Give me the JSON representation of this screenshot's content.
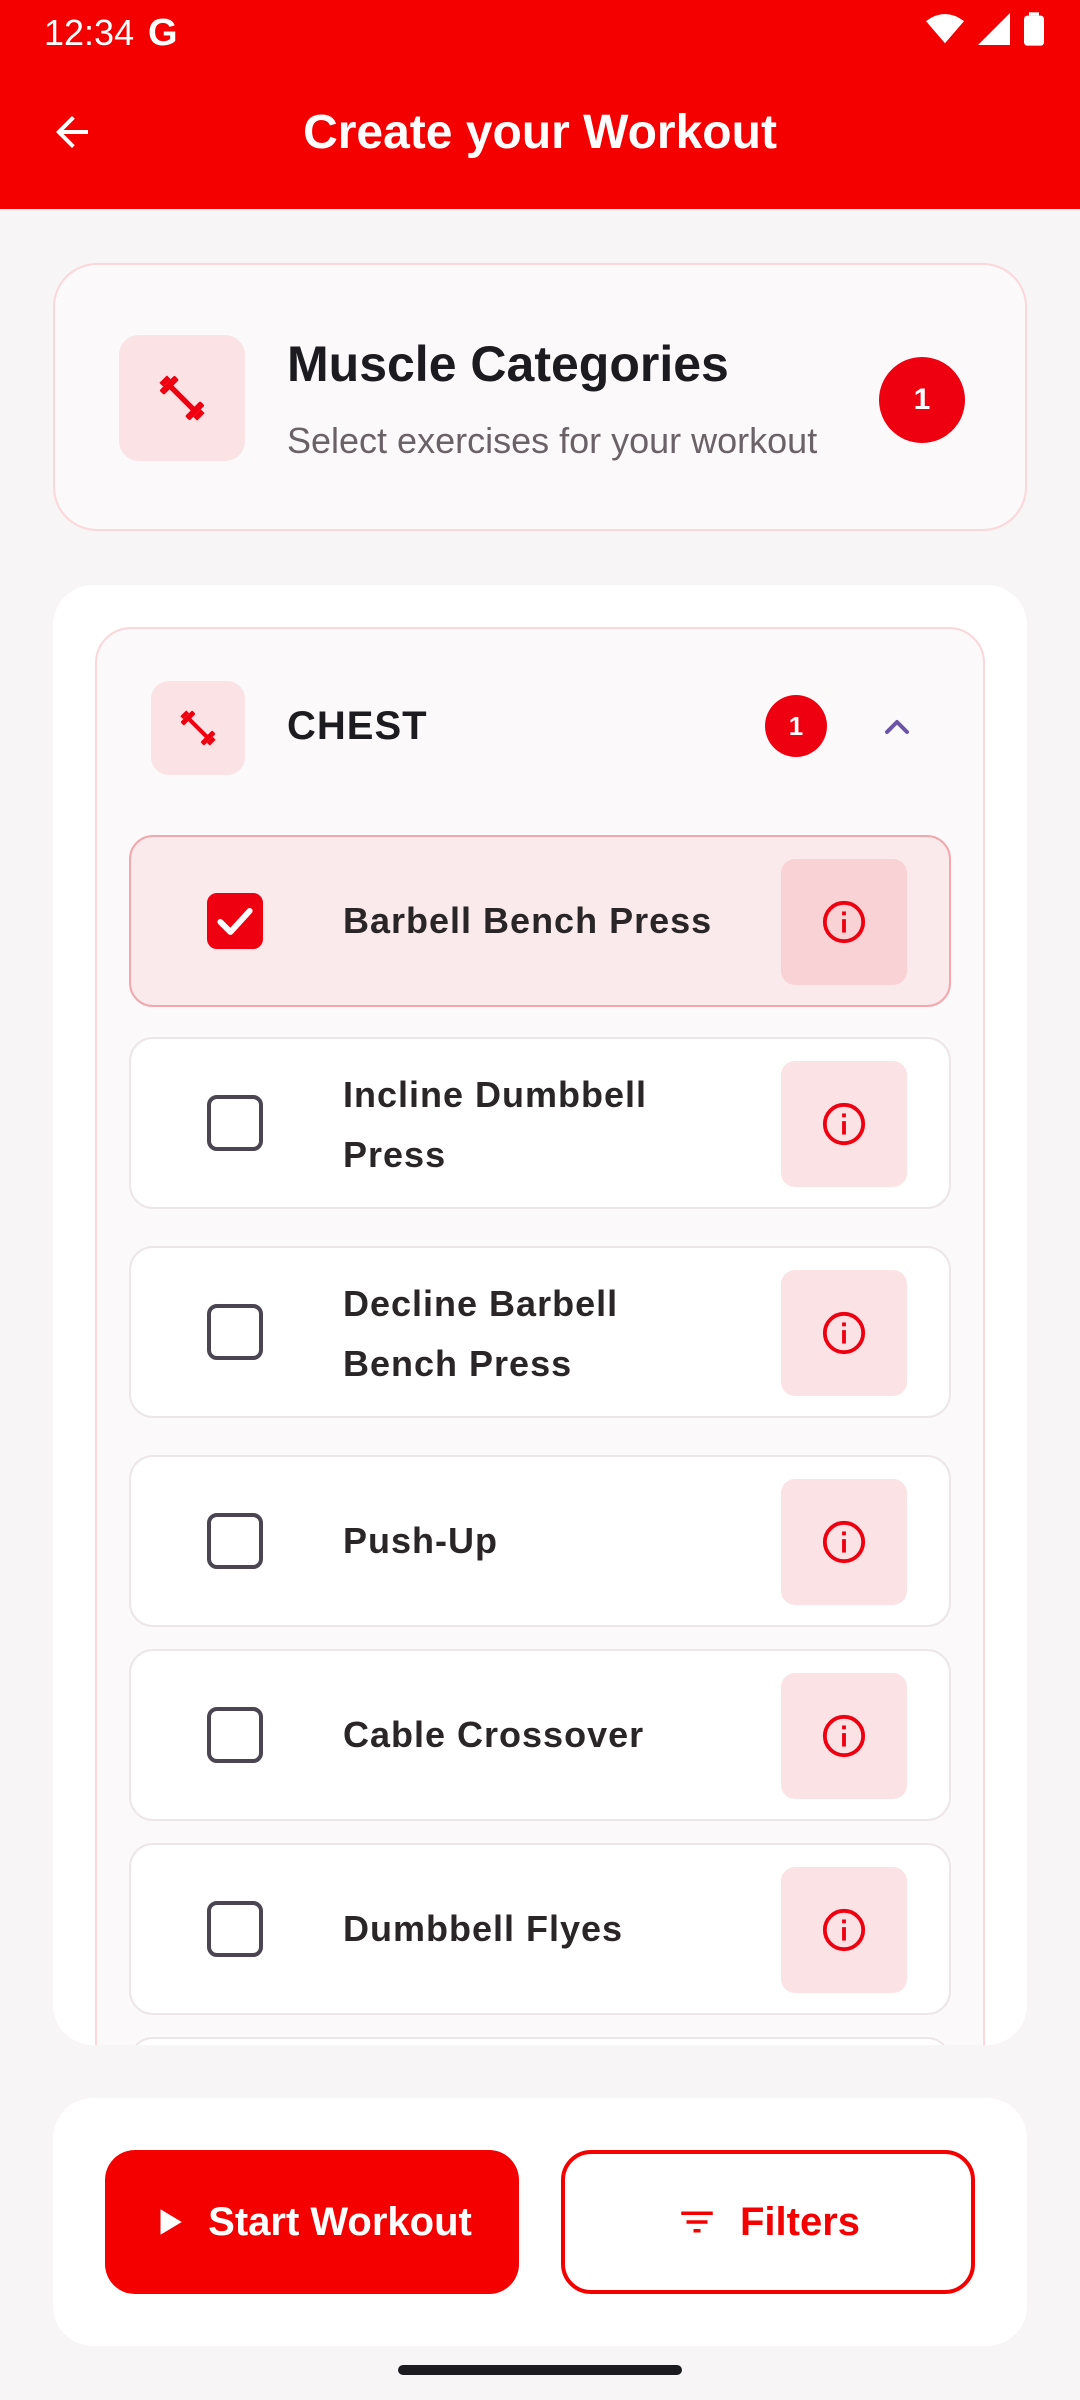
{
  "status_bar": {
    "time": "12:34",
    "g_label": "G"
  },
  "app_bar": {
    "title": "Create your Workout",
    "back_icon": "arrow-back-icon"
  },
  "header_card": {
    "title": "Muscle Categories",
    "subtitle": "Select exercises for your workout",
    "selected_count": "1",
    "icon": "dumbbell-icon"
  },
  "category": {
    "name": "CHEST",
    "selected_count": "1",
    "expanded": true,
    "exercises": [
      {
        "label_line1": "Barbell Bench Press",
        "label_line2": "",
        "checked": true
      },
      {
        "label_line1": "Incline Dumbbell",
        "label_line2": "Press",
        "checked": false
      },
      {
        "label_line1": "Decline Barbell",
        "label_line2": "Bench Press",
        "checked": false
      },
      {
        "label_line1": "Push-Up",
        "label_line2": "",
        "checked": false
      },
      {
        "label_line1": "Cable Crossover",
        "label_line2": "",
        "checked": false
      },
      {
        "label_line1": "Dumbbell Flyes",
        "label_line2": "",
        "checked": false
      }
    ]
  },
  "actions": {
    "start_label": "Start Workout",
    "filters_label": "Filters"
  },
  "colors": {
    "primary": "#f50000",
    "badge": "#ee0010",
    "tint": "#fbe2e4"
  }
}
